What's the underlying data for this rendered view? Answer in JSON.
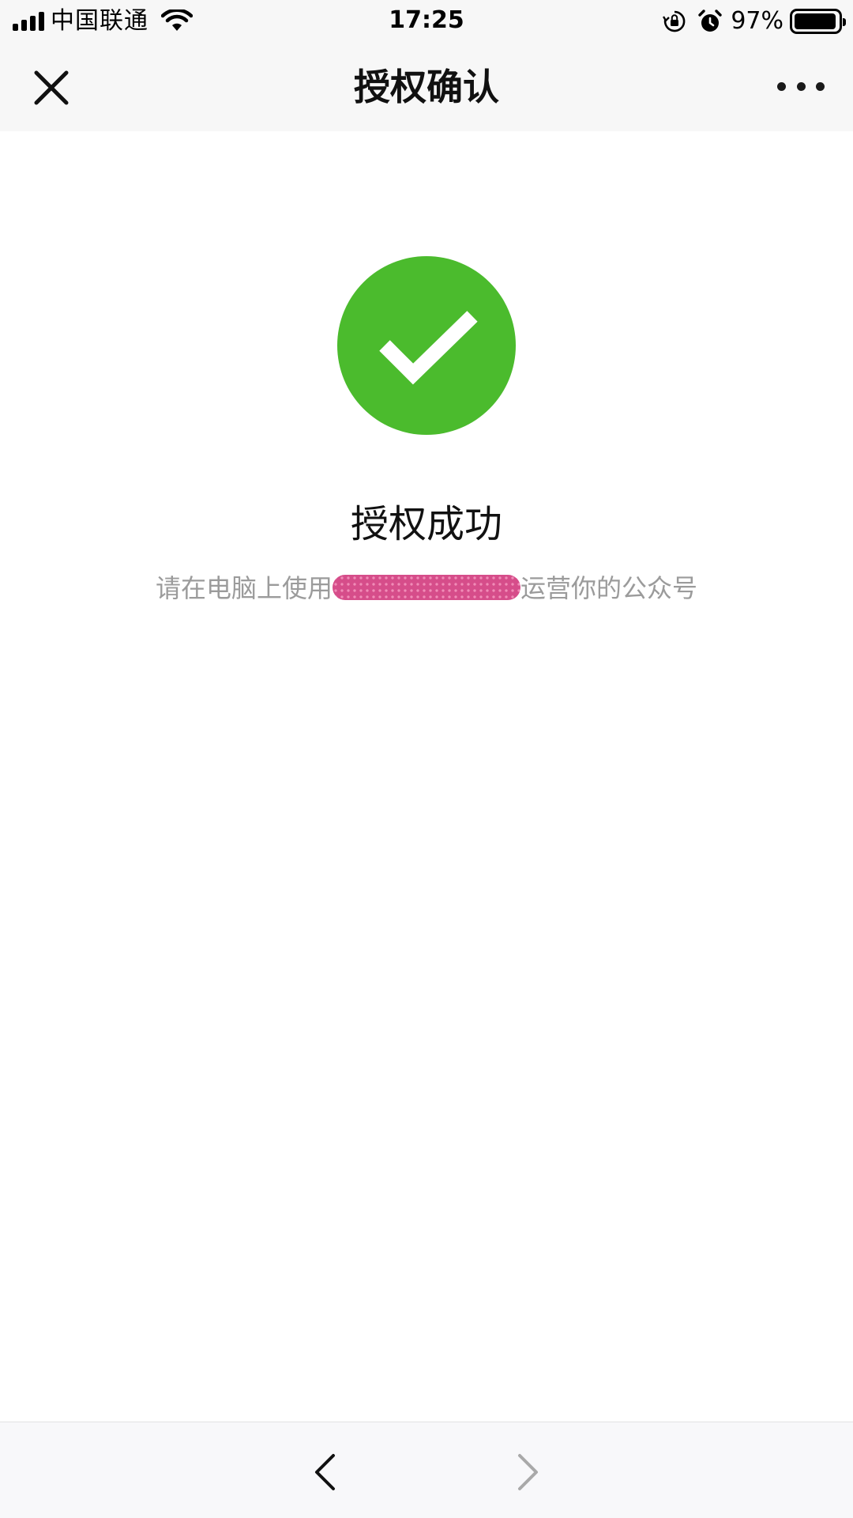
{
  "status_bar": {
    "carrier": "中国联通",
    "time": "17:25",
    "battery_percent": "97%",
    "battery_level": 0.97,
    "icons": [
      "signal-icon",
      "wifi-icon",
      "orientation-lock-icon",
      "alarm-icon",
      "battery-icon"
    ]
  },
  "nav": {
    "title": "授权确认",
    "close_icon": "close-icon",
    "more_icon": "more-icon"
  },
  "content": {
    "icon": "success-check-icon",
    "icon_color": "#4bbb2d",
    "title": "授权成功",
    "description_prefix": "请在电脑上使用",
    "description_suffix": "运营你的公众号"
  },
  "toolbar": {
    "back_icon": "back-arrow-icon",
    "forward_icon": "forward-arrow-icon",
    "forward_enabled": false
  }
}
